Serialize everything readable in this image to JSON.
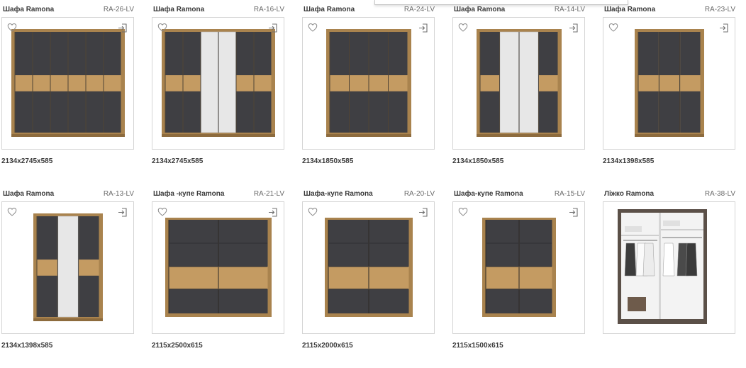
{
  "colors": {
    "wood": "#a9834e",
    "wood_light": "#c49b62",
    "panel_dark": "#3f3f43",
    "mirror": "#e7e7e7",
    "frame_border": "#d4d4d4"
  },
  "icons": {
    "favorite": "heart-outline-icon",
    "open": "sign-in-arrow-icon"
  },
  "products": [
    {
      "title": "Шафа Ramona",
      "code": "RA-26-LV",
      "dims": "2134x2745x585",
      "kind": "swing",
      "doors": "DDDDDD"
    },
    {
      "title": "Шафа Ramona",
      "code": "RA-16-LV",
      "dims": "2134x2745x585",
      "kind": "swing",
      "doors": "DDMMDD"
    },
    {
      "title": "Шафа Ramona",
      "code": "RA-24-LV",
      "dims": "2134x1850x585",
      "kind": "swing",
      "doors": "DDDD"
    },
    {
      "title": "Шафа Ramona",
      "code": "RA-14-LV",
      "dims": "2134x1850x585",
      "kind": "swing",
      "doors": "DMMD"
    },
    {
      "title": "Шафа Ramona",
      "code": "RA-23-LV",
      "dims": "2134x1398x585",
      "kind": "swing",
      "doors": "DDD"
    },
    {
      "title": "Шафа Ramona",
      "code": "RA-13-LV",
      "dims": "2134x1398x585",
      "kind": "swing",
      "doors": "DMD"
    },
    {
      "title": "Шафа -купе Ramona",
      "code": "RA-21-LV",
      "dims": "2115x2500x615",
      "kind": "sliding",
      "doors": "SS"
    },
    {
      "title": "Шафа-купе Ramona",
      "code": "RA-20-LV",
      "dims": "2115x2000x615",
      "kind": "sliding",
      "doors": "SS"
    },
    {
      "title": "Шафа-купе Ramona",
      "code": "RA-15-LV",
      "dims": "2115x1500x615",
      "kind": "sliding",
      "doors": "SS"
    },
    {
      "title": "Ліжко Ramona",
      "code": "RA-38-LV",
      "dims": "",
      "kind": "open",
      "doors": ""
    }
  ]
}
